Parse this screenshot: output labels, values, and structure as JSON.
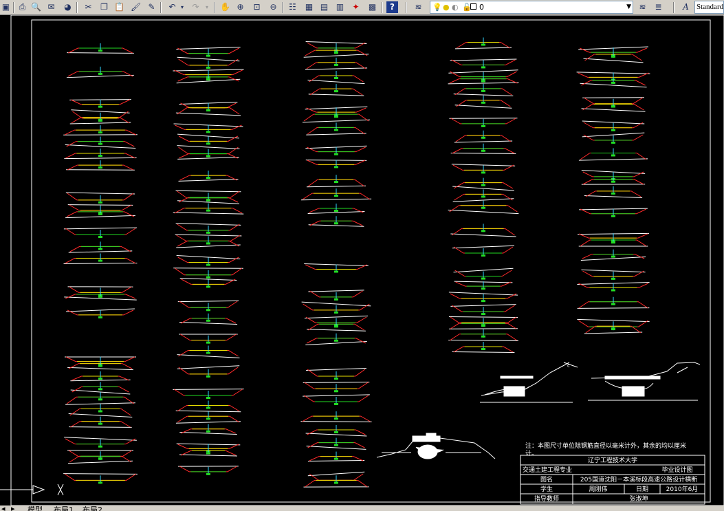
{
  "toolbar": {
    "layer_value": "0",
    "text_style_value": "Standard",
    "icons": [
      "new-icon",
      "open-icon",
      "print-icon",
      "preview-icon",
      "publish-icon",
      "plot-icon",
      "cut-icon",
      "copy-icon",
      "paste-icon",
      "match-properties-icon",
      "block-editor-icon",
      "undo-icon",
      "redo-icon",
      "pan-icon",
      "zoom-realtime-icon",
      "zoom-window-icon",
      "zoom-previous-icon",
      "properties-icon",
      "design-center-icon",
      "tool-palettes-icon",
      "sheet-set-icon",
      "markup-icon",
      "calculator-icon",
      "help-icon",
      "layer-manager-icon",
      "layer-states-icon",
      "make-current-icon",
      "layer-previous-icon",
      "text-style-icon"
    ]
  },
  "drawing": {
    "note": "注：本图尺寸单位除钢筋直径以毫米计外，其余的均以厘米计。",
    "title_block": {
      "school": "辽宁工程技术大学",
      "major": "交通土建工程专业",
      "doc_type": "毕业设计图",
      "drawing_name_label": "图名",
      "drawing_name": "205国道沈阳－本溪标段高速公路设计横断",
      "student_label": "学生",
      "student": "周刚伟",
      "date_label": "日期",
      "date": "2010年6月",
      "advisor_label": "指导教师",
      "advisor": "张淑坤"
    }
  },
  "tabs": {
    "model": "模型",
    "layout1": "布局1",
    "layout2": "布局2"
  }
}
